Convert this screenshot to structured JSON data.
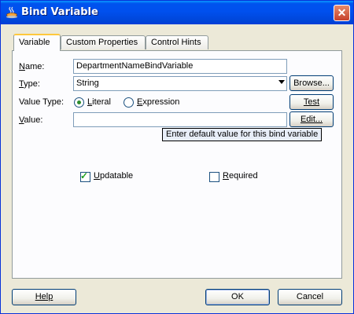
{
  "window": {
    "title": "Bind Variable",
    "close_glyph": "✕"
  },
  "tabs": [
    {
      "label": "Variable",
      "active": true
    },
    {
      "label": "Custom Properties",
      "active": false
    },
    {
      "label": "Control Hints",
      "active": false
    }
  ],
  "form": {
    "name": {
      "label_first": "N",
      "label_rest": "ame:",
      "value": "DepartmentNameBindVariable"
    },
    "type": {
      "label_first": "T",
      "label_rest": "ype:",
      "value": "String",
      "browse_label": "Browse..."
    },
    "value_type": {
      "label": "Value Type:",
      "literal": {
        "label_first": "L",
        "label_rest": "iteral",
        "selected": true
      },
      "expression": {
        "label_first": "E",
        "label_rest": "xpression",
        "selected": false
      },
      "test_label": "Test"
    },
    "value": {
      "label_first": "V",
      "label_rest": "alue:",
      "value": "",
      "edit_label": "Edit..."
    },
    "tooltip": "Enter default value for this bind variable",
    "updatable": {
      "label_first": "U",
      "label_rest": "pdatable",
      "checked": true
    },
    "required": {
      "label_first": "R",
      "label_rest": "equired",
      "checked": false
    }
  },
  "footer": {
    "help_label": "Help",
    "ok_label": "OK",
    "cancel_label": "Cancel"
  },
  "colors": {
    "title_bar": "#0050ee",
    "dialog_bg": "#ece9d8",
    "panel_bg": "#fcfcfe",
    "tab_highlight": "#ffc83c"
  }
}
